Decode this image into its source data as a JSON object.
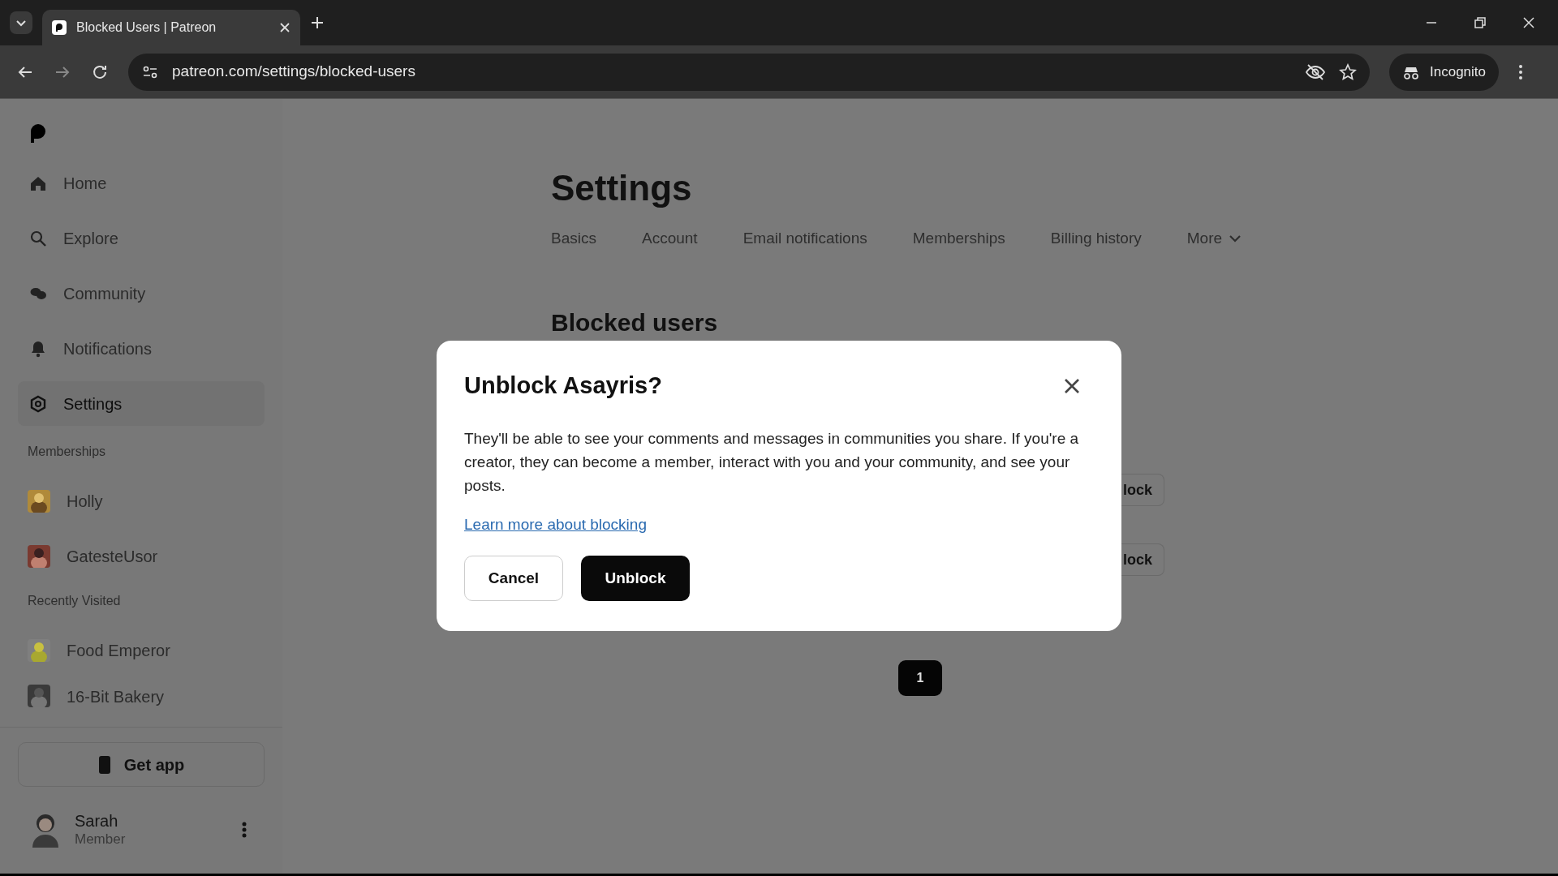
{
  "browser": {
    "tab_title": "Blocked Users | Patreon",
    "url": "patreon.com/settings/blocked-users",
    "profile_label": "Incognito"
  },
  "sidebar": {
    "nav": [
      {
        "label": "Home",
        "selected": false
      },
      {
        "label": "Explore",
        "selected": false
      },
      {
        "label": "Community",
        "selected": false
      },
      {
        "label": "Notifications",
        "selected": false
      },
      {
        "label": "Settings",
        "selected": true
      }
    ],
    "sections": [
      {
        "title": "Memberships",
        "items": [
          {
            "label": "Holly"
          },
          {
            "label": "GatesteUsor"
          }
        ]
      },
      {
        "title": "Recently Visited",
        "items": [
          {
            "label": "Food Emperor"
          },
          {
            "label": "16-Bit Bakery"
          }
        ]
      }
    ],
    "get_app": "Get app",
    "user": {
      "name": "Sarah",
      "role": "Member"
    }
  },
  "page": {
    "title": "Settings",
    "tabs": [
      {
        "label": "Basics",
        "dropdown": false
      },
      {
        "label": "Account",
        "dropdown": false
      },
      {
        "label": "Email notifications",
        "dropdown": false
      },
      {
        "label": "Memberships",
        "dropdown": false
      },
      {
        "label": "Billing history",
        "dropdown": false
      },
      {
        "label": "More",
        "dropdown": true
      }
    ],
    "section_title": "Blocked users",
    "row_buttons": [
      "lock",
      "lock"
    ],
    "pagination": [
      {
        "label": "1",
        "selected": true
      }
    ]
  },
  "dialog": {
    "title": "Unblock Asayris?",
    "body": "They'll be able to see your comments and messages in communities you share. If you're a creator, they can become a member, interact with you and your community, and see your posts.",
    "link": "Learn more about blocking",
    "cancel": "Cancel",
    "confirm": "Unblock"
  }
}
